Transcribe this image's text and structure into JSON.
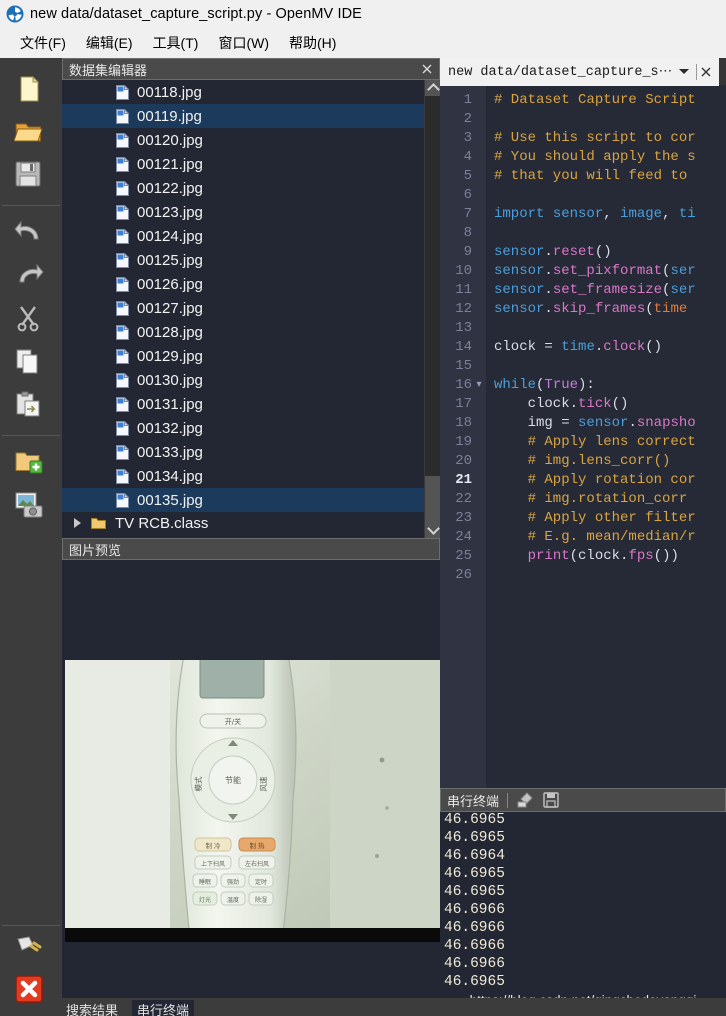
{
  "window": {
    "title": "new data/dataset_capture_script.py - OpenMV IDE",
    "logo_icon": "openmv-logo-icon"
  },
  "menubar": {
    "items": [
      {
        "label": "文件(F)",
        "name": "menu-file"
      },
      {
        "label": "编辑(E)",
        "name": "menu-edit"
      },
      {
        "label": "工具(T)",
        "name": "menu-tools"
      },
      {
        "label": "窗口(W)",
        "name": "menu-window"
      },
      {
        "label": "帮助(H)",
        "name": "menu-help"
      }
    ]
  },
  "toolbar": {
    "items": [
      {
        "name": "new-file-icon",
        "label": "新建文件"
      },
      {
        "name": "open-file-icon",
        "label": "打开文件"
      },
      {
        "name": "save-file-icon",
        "label": "保存文件"
      },
      {
        "name": "undo-icon",
        "label": "撤销"
      },
      {
        "name": "redo-icon",
        "label": "重做"
      },
      {
        "name": "cut-icon",
        "label": "剪切"
      },
      {
        "name": "copy-icon",
        "label": "复制"
      },
      {
        "name": "paste-icon",
        "label": "粘贴"
      },
      {
        "name": "new-dataset-folder-icon",
        "label": "新建数据集"
      },
      {
        "name": "capture-image-icon",
        "label": "采集图片"
      }
    ],
    "bottom_items": [
      {
        "name": "connect-plug-icon",
        "label": "连接"
      },
      {
        "name": "stop-script-icon",
        "label": "停止"
      }
    ]
  },
  "dataset_editor": {
    "title": "数据集编辑器",
    "close_icon": "close-icon",
    "selected_file": "00135.jpg",
    "files": [
      {
        "name": "00118.jpg",
        "selected": false
      },
      {
        "name": "00119.jpg",
        "selected": true
      },
      {
        "name": "00120.jpg",
        "selected": false
      },
      {
        "name": "00121.jpg",
        "selected": false
      },
      {
        "name": "00122.jpg",
        "selected": false
      },
      {
        "name": "00123.jpg",
        "selected": false
      },
      {
        "name": "00124.jpg",
        "selected": false
      },
      {
        "name": "00125.jpg",
        "selected": false
      },
      {
        "name": "00126.jpg",
        "selected": false
      },
      {
        "name": "00127.jpg",
        "selected": false
      },
      {
        "name": "00128.jpg",
        "selected": false
      },
      {
        "name": "00129.jpg",
        "selected": false
      },
      {
        "name": "00130.jpg",
        "selected": false
      },
      {
        "name": "00131.jpg",
        "selected": false
      },
      {
        "name": "00132.jpg",
        "selected": false
      },
      {
        "name": "00133.jpg",
        "selected": false
      },
      {
        "name": "00134.jpg",
        "selected": false
      },
      {
        "name": "00135.jpg",
        "selected": true
      }
    ],
    "class_folder": {
      "label": "TV RCB.class",
      "expanded": false
    },
    "scrollbar": {
      "up_icon": "chevron-up-icon",
      "down_icon": "chevron-down-icon"
    }
  },
  "image_preview": {
    "title": "图片预览",
    "photo_alt": "air-conditioner-remote-control-photo"
  },
  "editor": {
    "tab_label": "new data/dataset_capture_s⋯",
    "tab_caret_icon": "chevron-down-icon",
    "tab_close_icon": "close-icon",
    "current_line": 21,
    "lines": [
      {
        "n": 1,
        "fold": "",
        "tokens": [
          {
            "t": "# Dataset Capture Script",
            "c": "c-com"
          }
        ]
      },
      {
        "n": 2,
        "fold": "",
        "tokens": []
      },
      {
        "n": 3,
        "fold": "",
        "tokens": [
          {
            "t": "# Use this script to cor",
            "c": "c-com"
          }
        ]
      },
      {
        "n": 4,
        "fold": "",
        "tokens": [
          {
            "t": "# You should apply the s",
            "c": "c-com"
          }
        ]
      },
      {
        "n": 5,
        "fold": "",
        "tokens": [
          {
            "t": "# that you will feed to ",
            "c": "c-com"
          }
        ]
      },
      {
        "n": 6,
        "fold": "",
        "tokens": []
      },
      {
        "n": 7,
        "fold": "",
        "tokens": [
          {
            "t": "import",
            "c": "c-kw"
          },
          {
            "t": " sensor",
            "c": "c-mod"
          },
          {
            "t": ", ",
            "c": "c-punct"
          },
          {
            "t": "image",
            "c": "c-mod"
          },
          {
            "t": ", ",
            "c": "c-punct"
          },
          {
            "t": "ti",
            "c": "c-mod"
          }
        ]
      },
      {
        "n": 8,
        "fold": "",
        "tokens": []
      },
      {
        "n": 9,
        "fold": "",
        "tokens": [
          {
            "t": "sensor",
            "c": "c-mod"
          },
          {
            "t": ".",
            "c": "c-punct"
          },
          {
            "t": "reset",
            "c": "c-fn"
          },
          {
            "t": "()",
            "c": "c-punct"
          }
        ]
      },
      {
        "n": 10,
        "fold": "",
        "tokens": [
          {
            "t": "sensor",
            "c": "c-mod"
          },
          {
            "t": ".",
            "c": "c-punct"
          },
          {
            "t": "set_pixformat",
            "c": "c-fn"
          },
          {
            "t": "(",
            "c": "c-punct"
          },
          {
            "t": "ser",
            "c": "c-mod"
          }
        ]
      },
      {
        "n": 11,
        "fold": "",
        "tokens": [
          {
            "t": "sensor",
            "c": "c-mod"
          },
          {
            "t": ".",
            "c": "c-punct"
          },
          {
            "t": "set_framesize",
            "c": "c-fn"
          },
          {
            "t": "(",
            "c": "c-punct"
          },
          {
            "t": "ser",
            "c": "c-mod"
          }
        ]
      },
      {
        "n": 12,
        "fold": "",
        "tokens": [
          {
            "t": "sensor",
            "c": "c-mod"
          },
          {
            "t": ".",
            "c": "c-punct"
          },
          {
            "t": "skip_frames",
            "c": "c-fn"
          },
          {
            "t": "(",
            "c": "c-punct"
          },
          {
            "t": "time",
            "c": "c-num"
          },
          {
            "t": " ",
            "c": "c-punct"
          }
        ]
      },
      {
        "n": 13,
        "fold": "",
        "tokens": []
      },
      {
        "n": 14,
        "fold": "",
        "tokens": [
          {
            "t": "clock",
            "c": "c-plain"
          },
          {
            "t": " = ",
            "c": "c-punct"
          },
          {
            "t": "time",
            "c": "c-mod"
          },
          {
            "t": ".",
            "c": "c-punct"
          },
          {
            "t": "clock",
            "c": "c-fn"
          },
          {
            "t": "()",
            "c": "c-punct"
          }
        ]
      },
      {
        "n": 15,
        "fold": "",
        "tokens": []
      },
      {
        "n": 16,
        "fold": "v",
        "tokens": [
          {
            "t": "while",
            "c": "c-kw"
          },
          {
            "t": "(",
            "c": "c-punct"
          },
          {
            "t": "True",
            "c": "c-const"
          },
          {
            "t": "):",
            "c": "c-punct"
          }
        ]
      },
      {
        "n": 17,
        "fold": "",
        "tokens": [
          {
            "t": "    clock",
            "c": "c-plain"
          },
          {
            "t": ".",
            "c": "c-punct"
          },
          {
            "t": "tick",
            "c": "c-fn"
          },
          {
            "t": "()",
            "c": "c-punct"
          }
        ]
      },
      {
        "n": 18,
        "fold": "",
        "tokens": [
          {
            "t": "    img",
            "c": "c-plain"
          },
          {
            "t": " = ",
            "c": "c-punct"
          },
          {
            "t": "sensor",
            "c": "c-mod"
          },
          {
            "t": ".",
            "c": "c-punct"
          },
          {
            "t": "snapsho",
            "c": "c-fn"
          }
        ]
      },
      {
        "n": 19,
        "fold": "",
        "tokens": [
          {
            "t": "    # Apply lens correct",
            "c": "c-com"
          }
        ]
      },
      {
        "n": 20,
        "fold": "",
        "tokens": [
          {
            "t": "    # img.lens_corr()",
            "c": "c-com"
          }
        ]
      },
      {
        "n": 21,
        "fold": "",
        "tokens": [
          {
            "t": "    # Apply rotation cor",
            "c": "c-com"
          }
        ]
      },
      {
        "n": 22,
        "fold": "",
        "tokens": [
          {
            "t": "    # img.rotation_corr",
            "c": "c-com"
          }
        ]
      },
      {
        "n": 23,
        "fold": "",
        "tokens": [
          {
            "t": "    # Apply other filter",
            "c": "c-com"
          }
        ]
      },
      {
        "n": 24,
        "fold": "",
        "tokens": [
          {
            "t": "    # E.g. mean/median/r",
            "c": "c-com"
          }
        ]
      },
      {
        "n": 25,
        "fold": "",
        "tokens": [
          {
            "t": "    ",
            "c": "c-punct"
          },
          {
            "t": "print",
            "c": "c-fn"
          },
          {
            "t": "(",
            "c": "c-punct"
          },
          {
            "t": "clock",
            "c": "c-plain"
          },
          {
            "t": ".",
            "c": "c-punct"
          },
          {
            "t": "fps",
            "c": "c-fn"
          },
          {
            "t": "())",
            "c": "c-punct"
          }
        ]
      },
      {
        "n": 26,
        "fold": "",
        "tokens": []
      }
    ]
  },
  "terminal": {
    "title": "串行终端",
    "clear_icon": "clear-terminal-icon",
    "save_icon": "save-terminal-icon",
    "lines": [
      "46.6965",
      "46.6965",
      "46.6964",
      "46.6965",
      "46.6965",
      "46.6966",
      "46.6966",
      "46.6966",
      "46.6966",
      "46.6965"
    ]
  },
  "watermark": {
    "text": "https://blog.csdn.net/qingchedeyongqi"
  },
  "bottom_tabs": [
    {
      "label": "搜索结果",
      "active": false,
      "name": "tab-search-results"
    },
    {
      "label": "串行终端",
      "active": true,
      "name": "tab-serial-terminal"
    }
  ],
  "colors": {
    "chrome": "#f0f0f0",
    "toolbar_bg": "#3c3c3c",
    "panel_bg": "#232733",
    "panel_header": "#4a4a4a",
    "selection": "#1b3a5c",
    "editor_bg": "#262a36",
    "gutter_bg": "#2f3342",
    "comment": "#d9a441",
    "keyword": "#4a9edb",
    "function": "#d977c8",
    "constant": "#c879e0",
    "number": "#e07b39",
    "terminal_text": "#f0ead6"
  }
}
